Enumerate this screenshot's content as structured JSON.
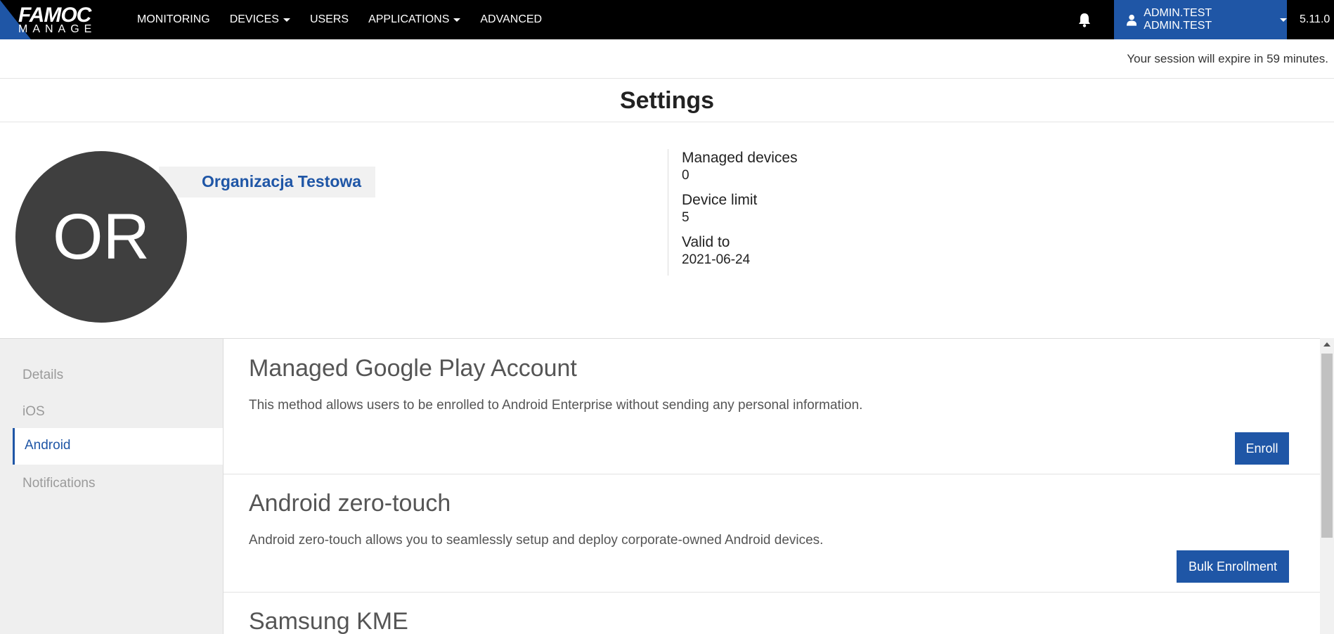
{
  "header": {
    "logo_top": "FAMOC",
    "logo_bottom": "MANAGE",
    "nav": [
      {
        "label": "MONITORING"
      },
      {
        "label": "DEVICES"
      },
      {
        "label": "USERS"
      },
      {
        "label": "APPLICATIONS"
      },
      {
        "label": "ADVANCED"
      }
    ],
    "user_label": "ADMIN.TEST ADMIN.TEST",
    "version": "5.11.0",
    "icons": {
      "bell": "bell-icon",
      "user": "user-icon"
    },
    "accent_color": "#1f56a6"
  },
  "session": {
    "text": "Your session will expire in 59 minutes."
  },
  "page": {
    "title": "Settings"
  },
  "organization": {
    "initials": "OR",
    "name": "Organizacja Testowa",
    "stats": [
      {
        "label": "Managed devices",
        "value": "0"
      },
      {
        "label": "Device limit",
        "value": "5"
      },
      {
        "label": "Valid to",
        "value": "2021-06-24"
      }
    ]
  },
  "sidebar": {
    "items": [
      {
        "label": "Details"
      },
      {
        "label": "iOS"
      },
      {
        "label": "Android"
      },
      {
        "label": "Notifications"
      }
    ],
    "active": "Android"
  },
  "sections": [
    {
      "title": "Managed Google Play Account",
      "description": "This method allows users to be enrolled to Android Enterprise without sending any personal information.",
      "button": "Enroll"
    },
    {
      "title": "Android zero-touch",
      "description": "Android zero-touch allows you to seamlessly setup and deploy corporate-owned Android devices.",
      "button": "Bulk Enrollment"
    },
    {
      "title": "Samsung KME"
    }
  ]
}
